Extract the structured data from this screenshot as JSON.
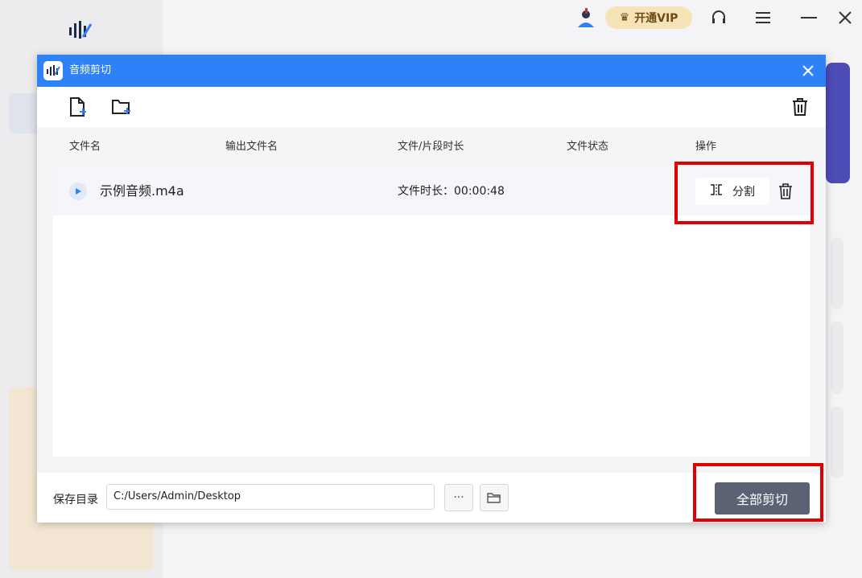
{
  "window": {
    "vip_label": "开通VIP"
  },
  "dialog": {
    "title": "音频剪切"
  },
  "table": {
    "headers": [
      "文件名",
      "输出文件名",
      "文件/片段时长",
      "文件状态",
      "操作"
    ],
    "rows": [
      {
        "file_name": "示例音频.m4a",
        "duration": "文件时长：00:00:48",
        "split_label": "分割"
      }
    ]
  },
  "footer": {
    "save_label": "保存目录",
    "path_value": "C:/Users/Admin/Desktop",
    "more_label": "···",
    "cut_all_label": "全部剪切"
  },
  "colors": {
    "titlebar": "#2f81f7",
    "cut_all_button": "#5b6274",
    "highlight_box": "#e00000"
  }
}
